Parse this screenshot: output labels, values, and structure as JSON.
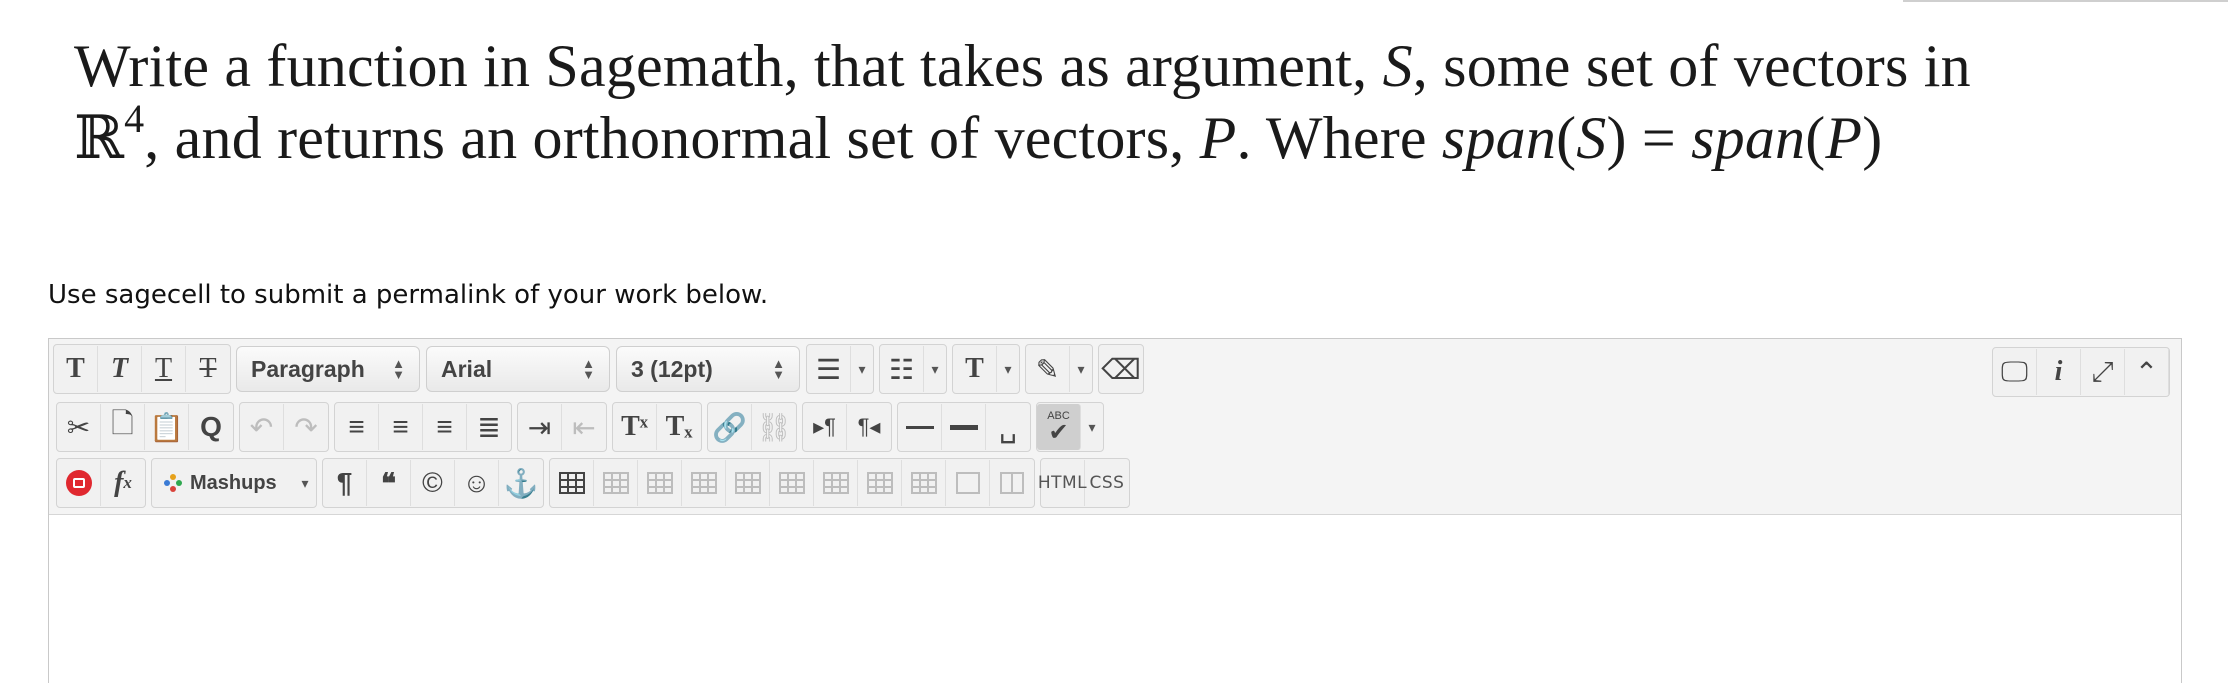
{
  "question": {
    "line1": "Write a function in Sagemath, that takes as argument, S, some set of vectors in",
    "line2": "ℝ⁴, and returns an orthonormal set of vectors, P. Where span(S) = span(P)"
  },
  "instruction": "Use sagecell to submit a permalink of your work below.",
  "toolbar": {
    "block_format": "Paragraph",
    "font_family": "Arial",
    "font_size": "3 (12pt)",
    "mashups_label": "Mashups",
    "html_label": "HTML",
    "css_label": "CSS",
    "spell_label": "ABC"
  },
  "editor": {
    "content": ""
  }
}
